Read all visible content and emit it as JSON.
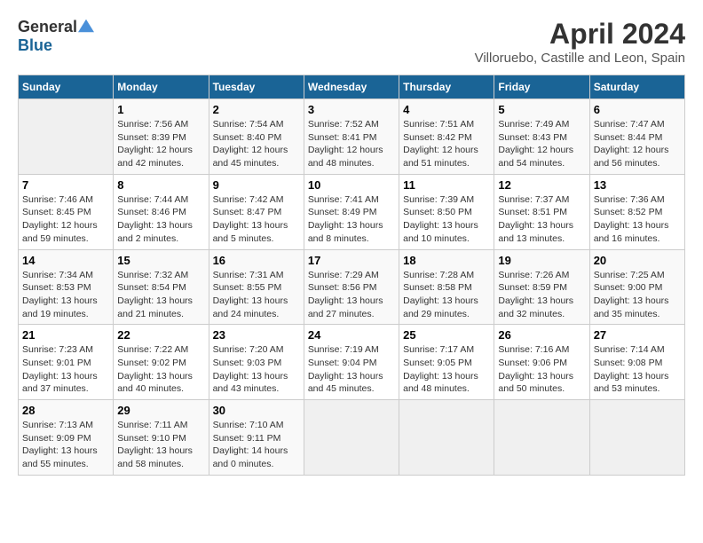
{
  "header": {
    "logo_general": "General",
    "logo_blue": "Blue",
    "month_title": "April 2024",
    "location": "Villoruebo, Castille and Leon, Spain"
  },
  "days_of_week": [
    "Sunday",
    "Monday",
    "Tuesday",
    "Wednesday",
    "Thursday",
    "Friday",
    "Saturday"
  ],
  "weeks": [
    [
      {
        "day": "",
        "info": ""
      },
      {
        "day": "1",
        "info": "Sunrise: 7:56 AM\nSunset: 8:39 PM\nDaylight: 12 hours\nand 42 minutes."
      },
      {
        "day": "2",
        "info": "Sunrise: 7:54 AM\nSunset: 8:40 PM\nDaylight: 12 hours\nand 45 minutes."
      },
      {
        "day": "3",
        "info": "Sunrise: 7:52 AM\nSunset: 8:41 PM\nDaylight: 12 hours\nand 48 minutes."
      },
      {
        "day": "4",
        "info": "Sunrise: 7:51 AM\nSunset: 8:42 PM\nDaylight: 12 hours\nand 51 minutes."
      },
      {
        "day": "5",
        "info": "Sunrise: 7:49 AM\nSunset: 8:43 PM\nDaylight: 12 hours\nand 54 minutes."
      },
      {
        "day": "6",
        "info": "Sunrise: 7:47 AM\nSunset: 8:44 PM\nDaylight: 12 hours\nand 56 minutes."
      }
    ],
    [
      {
        "day": "7",
        "info": "Sunrise: 7:46 AM\nSunset: 8:45 PM\nDaylight: 12 hours\nand 59 minutes."
      },
      {
        "day": "8",
        "info": "Sunrise: 7:44 AM\nSunset: 8:46 PM\nDaylight: 13 hours\nand 2 minutes."
      },
      {
        "day": "9",
        "info": "Sunrise: 7:42 AM\nSunset: 8:47 PM\nDaylight: 13 hours\nand 5 minutes."
      },
      {
        "day": "10",
        "info": "Sunrise: 7:41 AM\nSunset: 8:49 PM\nDaylight: 13 hours\nand 8 minutes."
      },
      {
        "day": "11",
        "info": "Sunrise: 7:39 AM\nSunset: 8:50 PM\nDaylight: 13 hours\nand 10 minutes."
      },
      {
        "day": "12",
        "info": "Sunrise: 7:37 AM\nSunset: 8:51 PM\nDaylight: 13 hours\nand 13 minutes."
      },
      {
        "day": "13",
        "info": "Sunrise: 7:36 AM\nSunset: 8:52 PM\nDaylight: 13 hours\nand 16 minutes."
      }
    ],
    [
      {
        "day": "14",
        "info": "Sunrise: 7:34 AM\nSunset: 8:53 PM\nDaylight: 13 hours\nand 19 minutes."
      },
      {
        "day": "15",
        "info": "Sunrise: 7:32 AM\nSunset: 8:54 PM\nDaylight: 13 hours\nand 21 minutes."
      },
      {
        "day": "16",
        "info": "Sunrise: 7:31 AM\nSunset: 8:55 PM\nDaylight: 13 hours\nand 24 minutes."
      },
      {
        "day": "17",
        "info": "Sunrise: 7:29 AM\nSunset: 8:56 PM\nDaylight: 13 hours\nand 27 minutes."
      },
      {
        "day": "18",
        "info": "Sunrise: 7:28 AM\nSunset: 8:58 PM\nDaylight: 13 hours\nand 29 minutes."
      },
      {
        "day": "19",
        "info": "Sunrise: 7:26 AM\nSunset: 8:59 PM\nDaylight: 13 hours\nand 32 minutes."
      },
      {
        "day": "20",
        "info": "Sunrise: 7:25 AM\nSunset: 9:00 PM\nDaylight: 13 hours\nand 35 minutes."
      }
    ],
    [
      {
        "day": "21",
        "info": "Sunrise: 7:23 AM\nSunset: 9:01 PM\nDaylight: 13 hours\nand 37 minutes."
      },
      {
        "day": "22",
        "info": "Sunrise: 7:22 AM\nSunset: 9:02 PM\nDaylight: 13 hours\nand 40 minutes."
      },
      {
        "day": "23",
        "info": "Sunrise: 7:20 AM\nSunset: 9:03 PM\nDaylight: 13 hours\nand 43 minutes."
      },
      {
        "day": "24",
        "info": "Sunrise: 7:19 AM\nSunset: 9:04 PM\nDaylight: 13 hours\nand 45 minutes."
      },
      {
        "day": "25",
        "info": "Sunrise: 7:17 AM\nSunset: 9:05 PM\nDaylight: 13 hours\nand 48 minutes."
      },
      {
        "day": "26",
        "info": "Sunrise: 7:16 AM\nSunset: 9:06 PM\nDaylight: 13 hours\nand 50 minutes."
      },
      {
        "day": "27",
        "info": "Sunrise: 7:14 AM\nSunset: 9:08 PM\nDaylight: 13 hours\nand 53 minutes."
      }
    ],
    [
      {
        "day": "28",
        "info": "Sunrise: 7:13 AM\nSunset: 9:09 PM\nDaylight: 13 hours\nand 55 minutes."
      },
      {
        "day": "29",
        "info": "Sunrise: 7:11 AM\nSunset: 9:10 PM\nDaylight: 13 hours\nand 58 minutes."
      },
      {
        "day": "30",
        "info": "Sunrise: 7:10 AM\nSunset: 9:11 PM\nDaylight: 14 hours\nand 0 minutes."
      },
      {
        "day": "",
        "info": ""
      },
      {
        "day": "",
        "info": ""
      },
      {
        "day": "",
        "info": ""
      },
      {
        "day": "",
        "info": ""
      }
    ]
  ]
}
